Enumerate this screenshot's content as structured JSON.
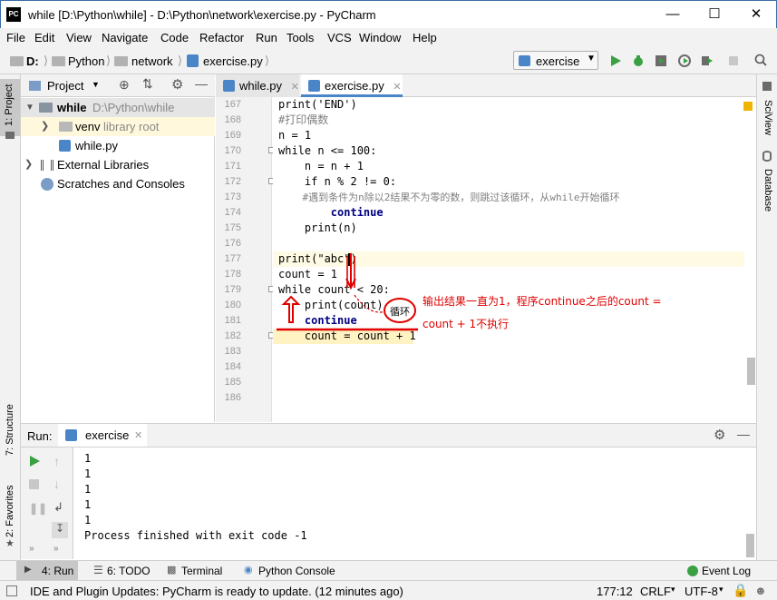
{
  "window": {
    "title": "while [D:\\Python\\while] - D:\\Python\\network\\exercise.py - PyCharm",
    "app_icon": "PC"
  },
  "menu": [
    "File",
    "Edit",
    "View",
    "Navigate",
    "Code",
    "Refactor",
    "Run",
    "Tools",
    "VCS",
    "Window",
    "Help"
  ],
  "breadcrumbs": [
    "D:",
    "Python",
    "network",
    "exercise.py"
  ],
  "run_config": "exercise",
  "left_tools": {
    "project": "1: Project",
    "structure": "7: Structure",
    "favorites": "2: Favorites"
  },
  "right_tools": {
    "sciview": "SciView",
    "database": "Database"
  },
  "project_panel": {
    "title": "Project",
    "tree": [
      {
        "label": "while",
        "hint": "D:\\Python\\while"
      },
      {
        "label": "venv",
        "hint": "library root"
      },
      {
        "label": "while.py",
        "hint": ""
      },
      {
        "label": "External Libraries",
        "hint": ""
      },
      {
        "label": "Scratches and Consoles",
        "hint": ""
      }
    ]
  },
  "editor_tabs": [
    "while.py",
    "exercise.py"
  ],
  "editor": {
    "line_numbers": [
      "167",
      "168",
      "169",
      "170",
      "171",
      "172",
      "173",
      "174",
      "175",
      "176",
      "177",
      "178",
      "179",
      "180",
      "181",
      "182",
      "183",
      "184",
      "185",
      "186"
    ],
    "lines": [
      "print('END')",
      "#打印偶数",
      "n = 1",
      "while n <= 100:",
      "    n = n + 1",
      "    if n % 2 != 0:",
      "    #遇到条件为n除以2结果不为零的数，则跳过该循环，从while开始循环",
      "        continue",
      "    print(n)",
      "",
      "print(\"abc\")",
      "count = 1",
      "while count < 20:",
      "    print(count)",
      "    continue",
      "    count = count + 1",
      "",
      "",
      "",
      ""
    ]
  },
  "annotations": {
    "loop_bubble": "循环",
    "note_line1": "输出结果一直为1，程序continue之后的count =",
    "note_line2": "count + 1不执行"
  },
  "run_panel": {
    "label": "Run:",
    "tab": "exercise",
    "output": [
      "1",
      "1",
      "1",
      "1",
      "1",
      "Process finished with exit code -1"
    ]
  },
  "bottom_tabs": [
    "4: Run",
    "6: TODO",
    "Terminal",
    "Python Console",
    "Event Log"
  ],
  "status": {
    "message": "IDE and Plugin Updates: PyCharm is ready to update. (12 minutes ago)",
    "position": "177:12",
    "line_sep": "CRLF",
    "encoding": "UTF-8"
  },
  "colors": {
    "accent_run": "#3aa142",
    "annotation": "#e00000",
    "keyword": "#000080",
    "string": "#008000"
  }
}
